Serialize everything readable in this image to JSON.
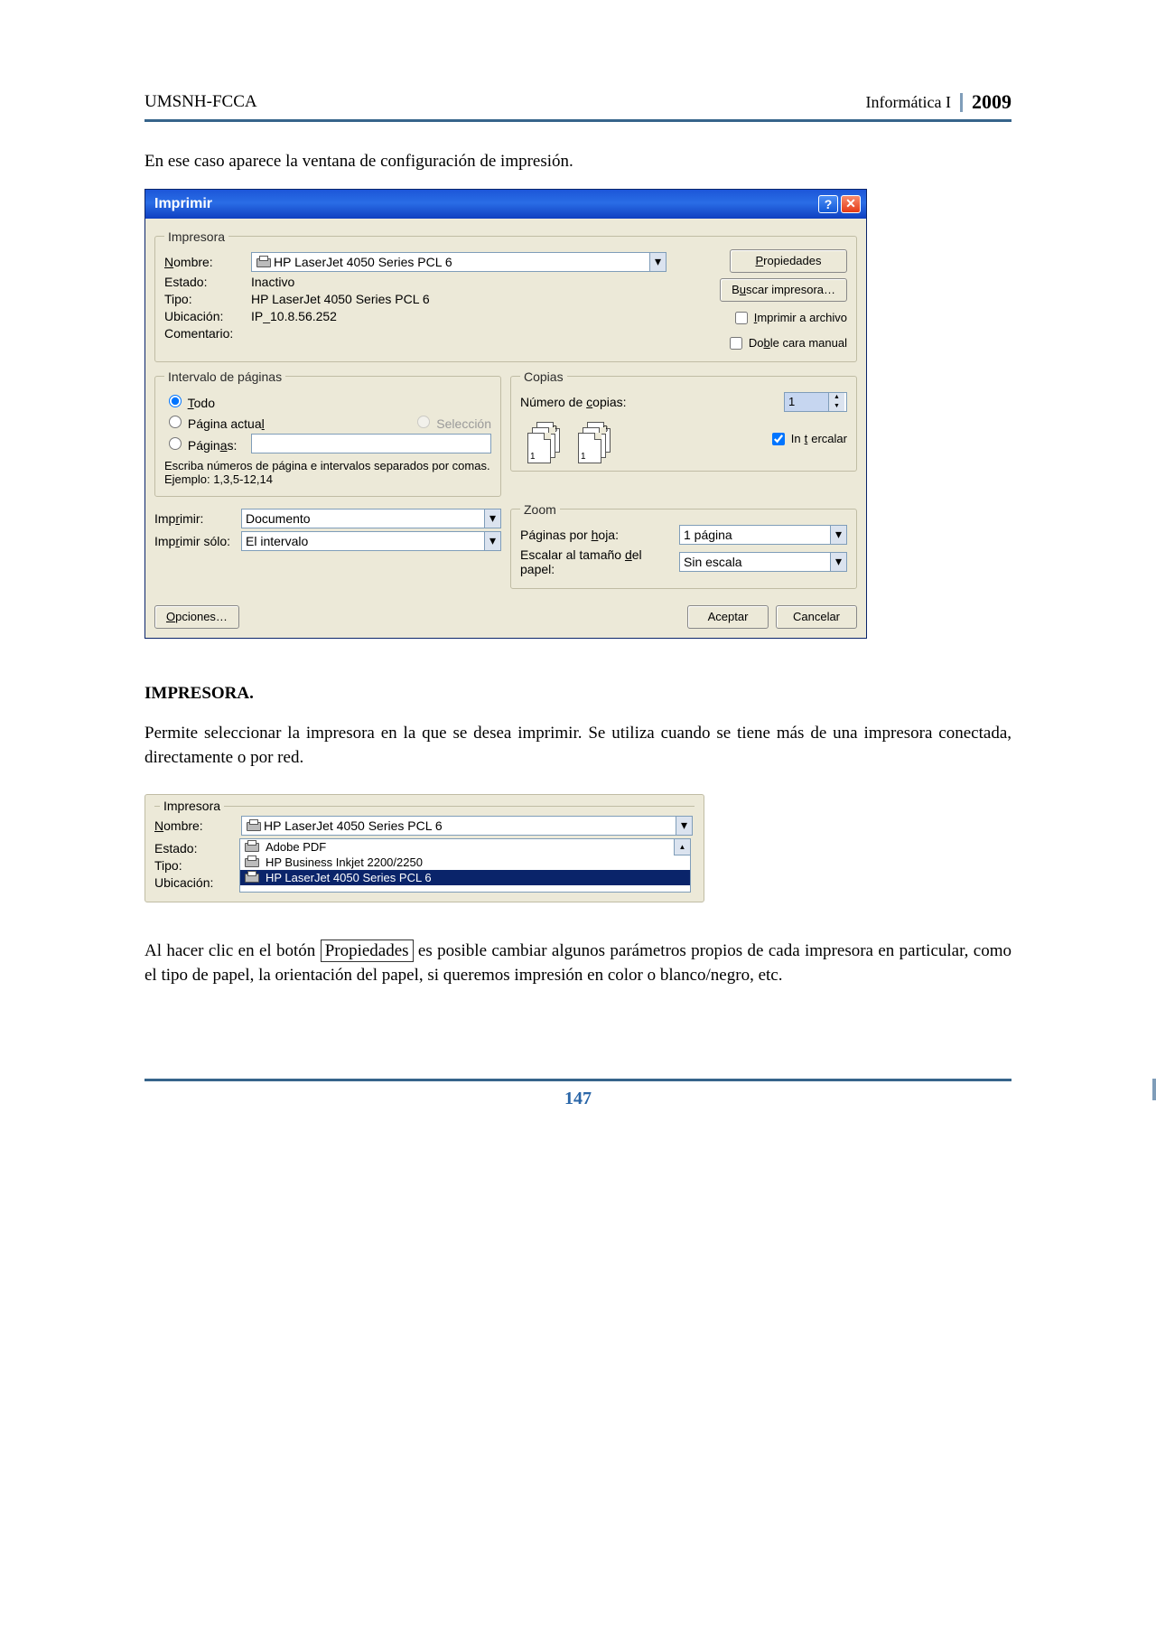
{
  "header": {
    "left": "UMSNH-FCCA",
    "course": "Informática I",
    "year": "2009"
  },
  "intro": "En ese caso aparece la ventana de configuración de impresión.",
  "dialog": {
    "title": "Imprimir",
    "printer_group": "Impresora",
    "labels": {
      "name": "Nombre:",
      "state": "Estado:",
      "type": "Tipo:",
      "location": "Ubicación:",
      "comment": "Comentario:"
    },
    "printer_name": "HP LaserJet 4050 Series PCL 6",
    "state": "Inactivo",
    "type": "HP LaserJet 4050 Series PCL 6",
    "location": "IP_10.8.56.252",
    "buttons": {
      "properties": "Propiedades",
      "find": "Buscar impresora…",
      "print_to_file": "Imprimir a archivo",
      "manual_duplex": "Doble cara manual"
    },
    "range_group": "Intervalo de páginas",
    "range": {
      "all": "Todo",
      "current": "Página actual",
      "selection": "Selección",
      "pages": "Páginas:",
      "hint": "Escriba números de página e intervalos separados por comas. Ejemplo: 1,3,5-12,14"
    },
    "copies_group": "Copias",
    "copies": {
      "label": "Número de copias:",
      "value": "1",
      "collate": "Intercalar"
    },
    "print_what_label": "Imprimir:",
    "print_what": "Documento",
    "print_only_label": "Imprimir sólo:",
    "print_only": "El intervalo",
    "zoom_group": "Zoom",
    "zoom": {
      "pages_per_sheet_label": "Páginas por hoja:",
      "pages_per_sheet": "1 página",
      "scale_label": "Escalar al tamaño del papel:",
      "scale": "Sin escala"
    },
    "options": "Opciones…",
    "ok": "Aceptar",
    "cancel": "Cancelar"
  },
  "section_title": "IMPRESORA.",
  "section_body": "Permite seleccionar la impresora en la que se desea imprimir. Se utiliza cuando se tiene más de una impresora conectada, directamente o por red.",
  "dialog2": {
    "group": "Impresora",
    "labels": {
      "name": "Nombre:",
      "state": "Estado:",
      "type": "Tipo:",
      "location": "Ubicación:"
    },
    "selected": "HP LaserJet 4050 Series PCL 6",
    "options": [
      "Adobe PDF",
      "HP Business Inkjet 2200/2250",
      "HP LaserJet 4050 Series PCL 6"
    ]
  },
  "after_text_1": "Al hacer clic en el botón ",
  "after_inline": "Propiedades",
  "after_text_2": " es posible cambiar algunos parámetros propios de cada impresora en particular, como el tipo de papel, la orientación del papel, si queremos impresión en color o blanco/negro, etc.",
  "page_number": "147"
}
